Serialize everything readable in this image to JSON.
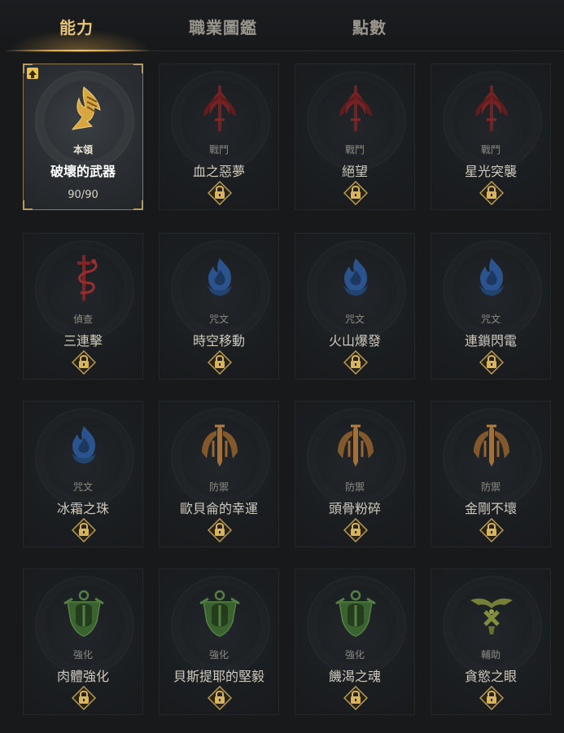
{
  "tabs": [
    {
      "label": "能力",
      "active": true
    },
    {
      "label": "職業圖鑑",
      "active": false
    },
    {
      "label": "點數",
      "active": false
    }
  ],
  "colors": {
    "accent_gold": "#e6c27a",
    "weapon_red": "#8a2a2a",
    "spell_blue": "#2f5a9a",
    "defense_bronze": "#9a6a36",
    "enhance_green": "#3f6a32",
    "support_olive": "#7f8a3a"
  },
  "abilities": [
    {
      "category": "本領",
      "name": "破壞的武器",
      "count": "90/90",
      "icon": "winged-boot-icon",
      "selected": true,
      "locked": false
    },
    {
      "category": "戰鬥",
      "name": "血之惡夢",
      "icon": "crimson-trident-icon",
      "locked": true
    },
    {
      "category": "戰鬥",
      "name": "絕望",
      "icon": "crimson-trident-icon",
      "locked": true
    },
    {
      "category": "戰鬥",
      "name": "星光突襲",
      "icon": "crimson-trident-icon",
      "locked": true
    },
    {
      "category": "偵查",
      "name": "三連擊",
      "icon": "serpent-dagger-icon",
      "locked": true
    },
    {
      "category": "咒文",
      "name": "時空移動",
      "icon": "blue-flame-icon",
      "locked": true
    },
    {
      "category": "咒文",
      "name": "火山爆發",
      "icon": "blue-flame-icon",
      "locked": true
    },
    {
      "category": "咒文",
      "name": "連鎖閃電",
      "icon": "blue-flame-icon",
      "locked": true
    },
    {
      "category": "咒文",
      "name": "冰霜之珠",
      "icon": "blue-flame-icon",
      "locked": true
    },
    {
      "category": "防禦",
      "name": "歐貝侖的幸運",
      "icon": "bronze-wings-icon",
      "locked": true
    },
    {
      "category": "防禦",
      "name": "頭骨粉碎",
      "icon": "bronze-wings-icon",
      "locked": true
    },
    {
      "category": "防禦",
      "name": "金剛不壞",
      "icon": "bronze-wings-icon",
      "locked": true
    },
    {
      "category": "強化",
      "name": "肉體強化",
      "icon": "green-helm-icon",
      "locked": true
    },
    {
      "category": "強化",
      "name": "貝斯提耶的堅毅",
      "icon": "green-helm-icon",
      "locked": true
    },
    {
      "category": "強化",
      "name": "饑渴之魂",
      "icon": "green-helm-icon",
      "locked": true
    },
    {
      "category": "輔助",
      "name": "貪慾之眼",
      "icon": "olive-sigil-icon",
      "locked": true
    }
  ]
}
